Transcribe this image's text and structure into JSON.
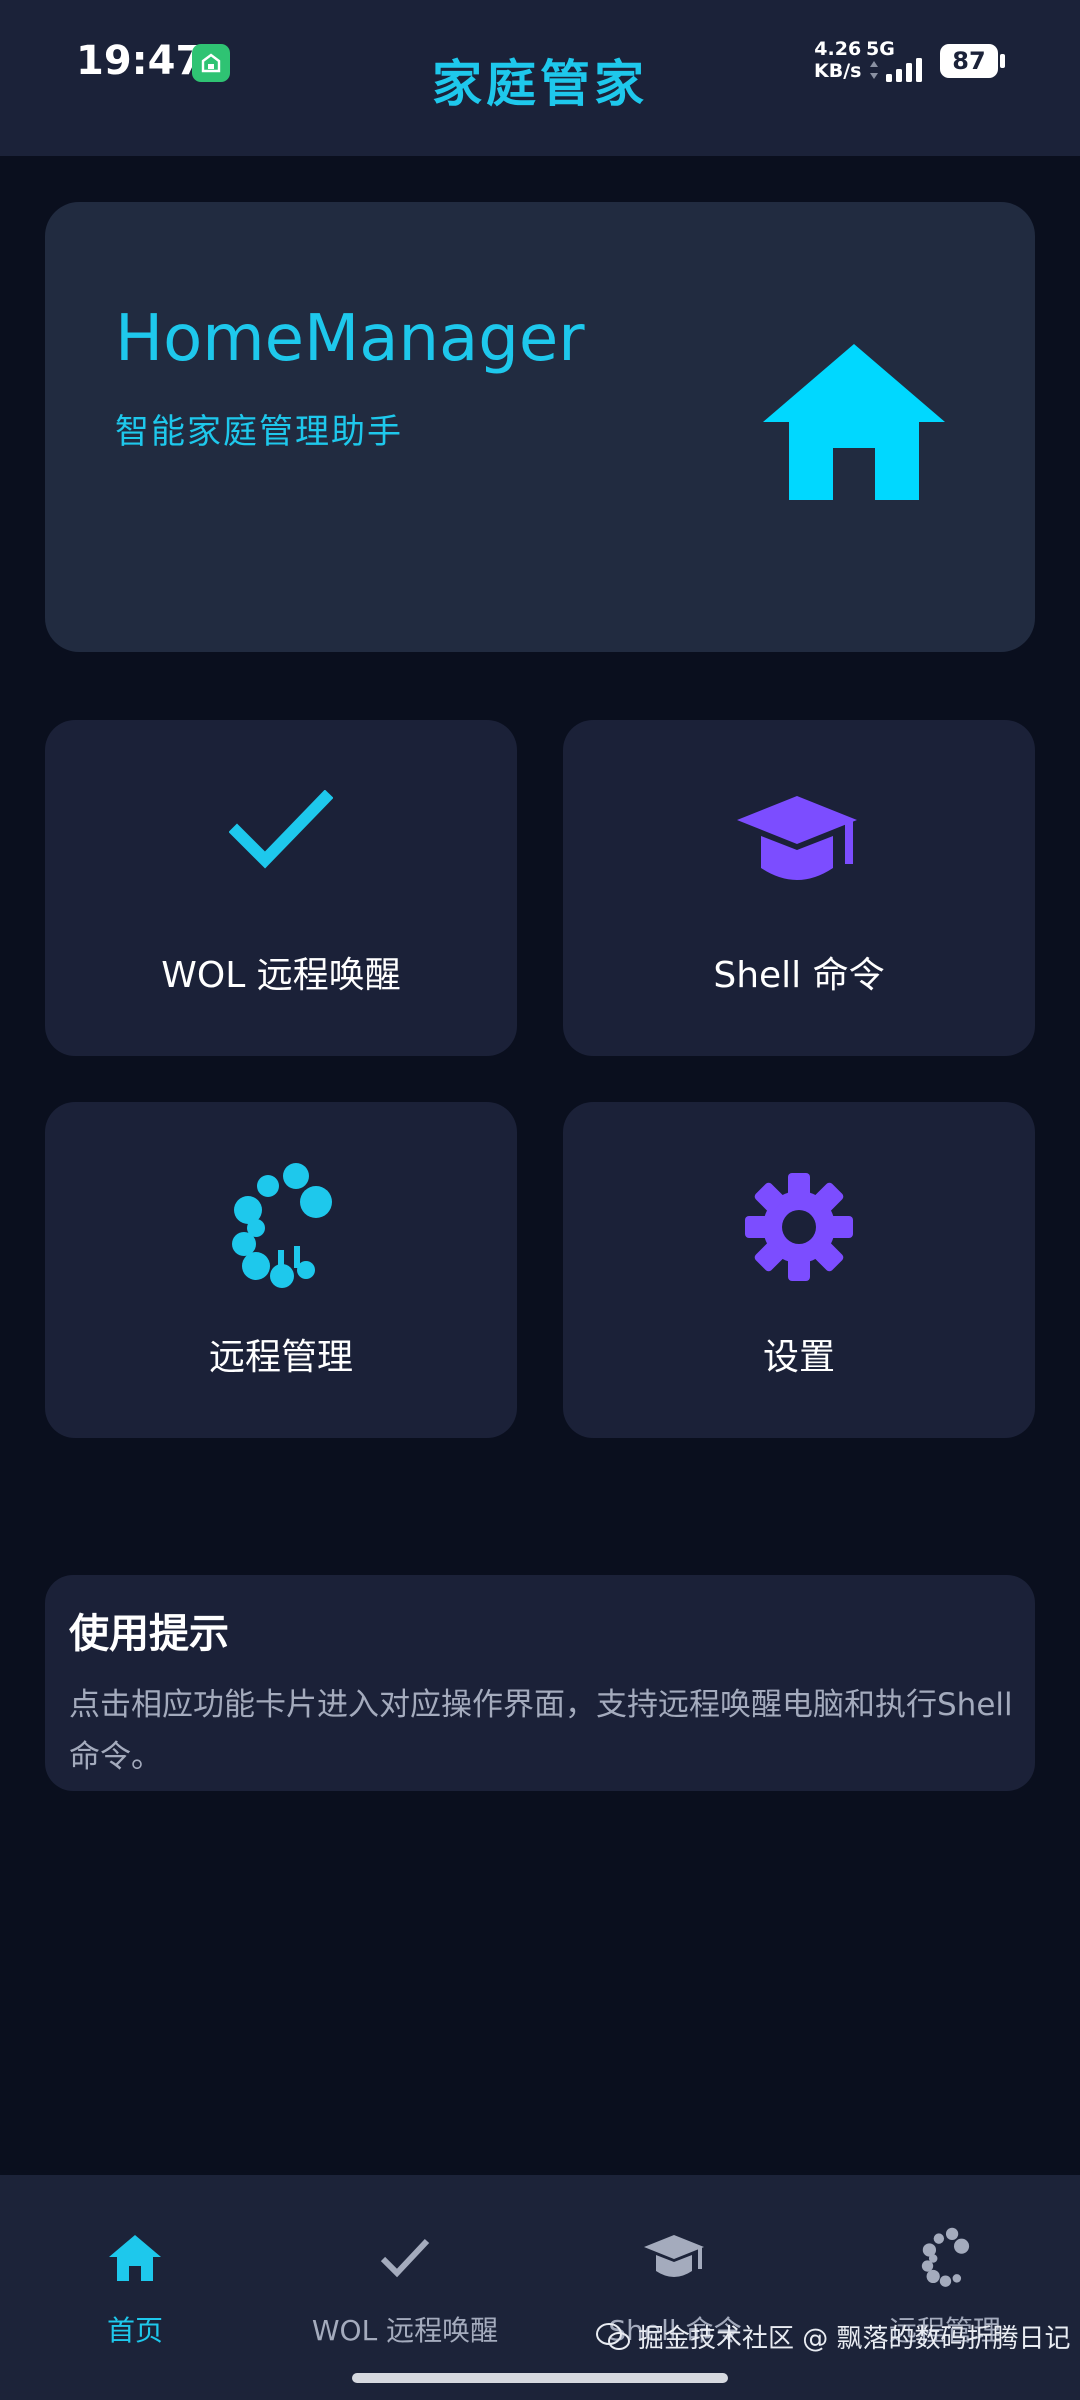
{
  "status_bar": {
    "time": "19:47",
    "net_speed_value": "4.26",
    "net_speed_unit": "KB/s",
    "network": "5G",
    "battery": "87"
  },
  "app_title": "家庭管家",
  "hero": {
    "title": "HomeManager",
    "subtitle": "智能家庭管理助手",
    "icon": "home-icon"
  },
  "features": [
    {
      "label": "WOL 远程唤醒",
      "icon": "checkmark-icon"
    },
    {
      "label": "Shell 命令",
      "icon": "graduation-cap-icon"
    },
    {
      "label": "远程管理",
      "icon": "remote-management-icon"
    },
    {
      "label": "设置",
      "icon": "gear-icon"
    }
  ],
  "tips": {
    "title": "使用提示",
    "body": "点击相应功能卡片进入对应操作界面，支持远程唤醒电脑和执行Shell命令。"
  },
  "bottom_nav": {
    "items": [
      {
        "label": "首页",
        "icon": "home-icon",
        "active": true
      },
      {
        "label": "WOL 远程唤醒",
        "icon": "checkmark-icon",
        "active": false
      },
      {
        "label": "Shell 命令",
        "icon": "graduation-cap-icon",
        "active": false
      },
      {
        "label": "远程管理",
        "icon": "remote-management-icon",
        "active": false
      }
    ]
  },
  "watermark": "掘金技术社区 @ 飘落的数码折腾日记",
  "colors": {
    "accent": "#1ec8ec",
    "purple": "#7c4dff",
    "background": "#0a0f1e",
    "card": "#1b2138",
    "hero_card": "#212b40",
    "inactive": "#a4abbd"
  }
}
